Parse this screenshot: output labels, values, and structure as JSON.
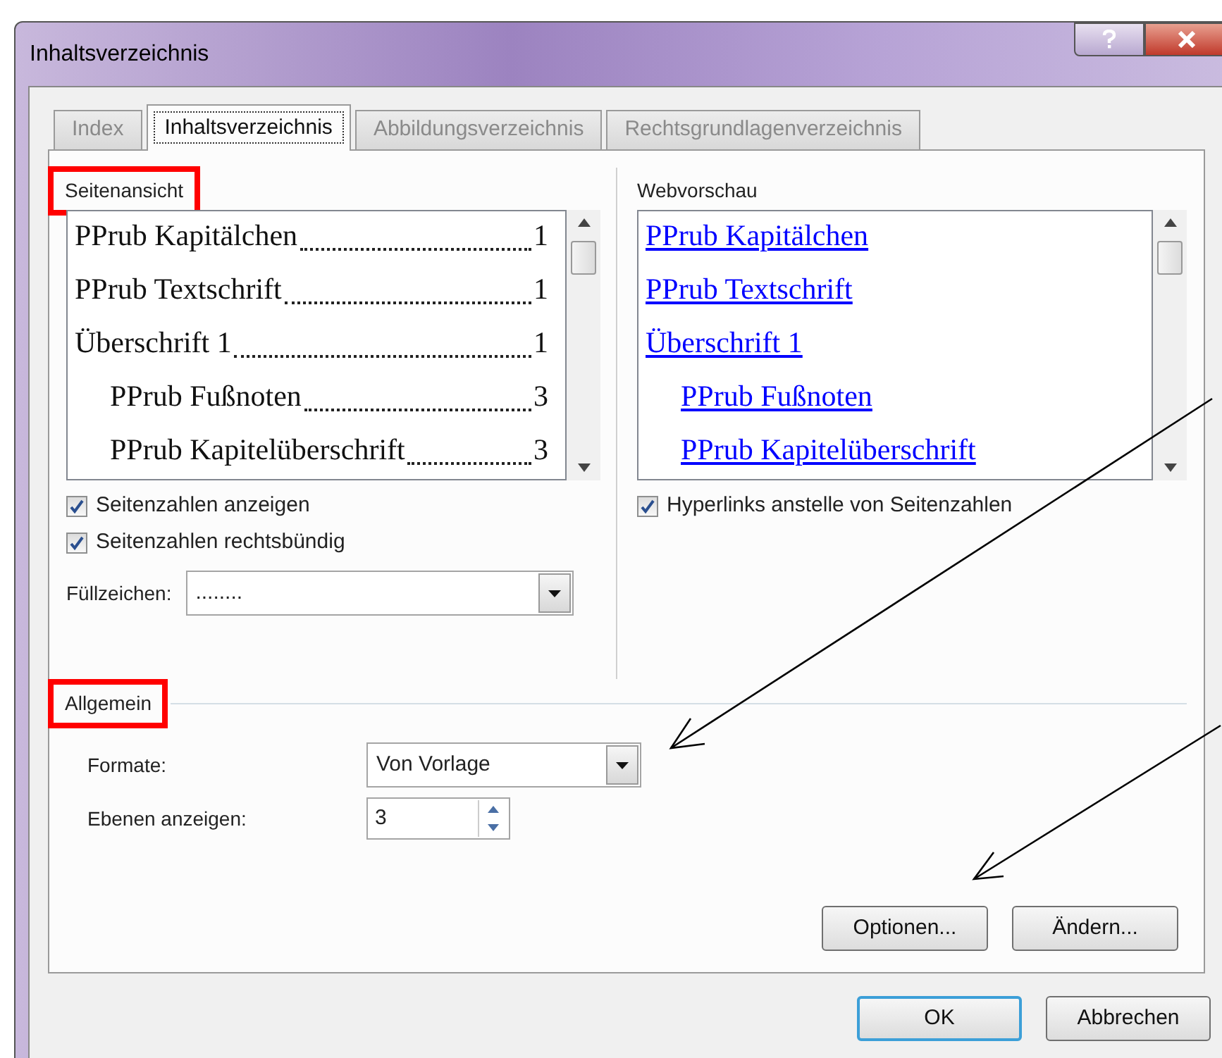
{
  "window": {
    "title": "Inhaltsverzeichnis"
  },
  "tabs": [
    {
      "label": "Index",
      "selected": false
    },
    {
      "label": "Inhaltsverzeichnis",
      "selected": true
    },
    {
      "label": "Abbildungsverzeichnis",
      "selected": false
    },
    {
      "label": "Rechtsgrundlagenverzeichnis",
      "selected": false
    }
  ],
  "print_preview": {
    "label": "Seitenansicht",
    "highlighted": true,
    "entries": [
      {
        "text": "PPrub Kapitälchen",
        "page": "1"
      },
      {
        "text": "PPrub Textschrift",
        "page": "1"
      },
      {
        "text": "Überschrift 1",
        "page": "1",
        "children": [
          {
            "text": "PPrub Fußnoten",
            "page": "3"
          },
          {
            "text": "PPrub Kapitelüberschrift",
            "page": "3"
          }
        ]
      }
    ],
    "options": [
      {
        "label": "Seitenzahlen anzeigen",
        "checked": true
      },
      {
        "label": "Seitenzahlen rechtsbündig",
        "checked": true
      }
    ],
    "fill_char": {
      "label": "Füllzeichen:",
      "value": "........"
    }
  },
  "web_preview": {
    "label": "Webvorschau",
    "entries": [
      {
        "text": "PPrub Kapitälchen"
      },
      {
        "text": "PPrub Textschrift"
      },
      {
        "text": "Überschrift 1",
        "children": [
          {
            "text": "PPrub Fußnoten"
          },
          {
            "text": "PPrub Kapitelüberschrift"
          }
        ]
      }
    ],
    "options": [
      {
        "label": "Hyperlinks anstelle von Seitenzahlen",
        "checked": true
      }
    ]
  },
  "general": {
    "label": "Allgemein",
    "highlighted": true,
    "formats": {
      "label": "Formate:",
      "value": "Von Vorlage"
    },
    "levels": {
      "label": "Ebenen anzeigen:",
      "value": "3"
    }
  },
  "panel_buttons": [
    "Optionen...",
    "Ändern..."
  ],
  "footer_buttons": [
    {
      "label": "OK",
      "default": true
    },
    {
      "label": "Abbrechen",
      "default": false
    }
  ]
}
